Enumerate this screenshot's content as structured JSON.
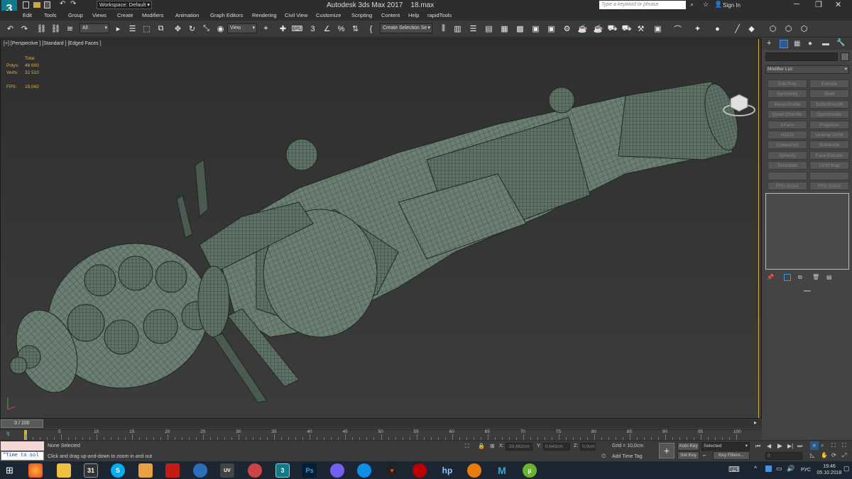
{
  "title_bar": {
    "app_icon_label": "3",
    "workspace_label": "Workspace: Default",
    "app_name": "Autodesk 3ds Max 2017",
    "file_name": "18.max",
    "search_placeholder": "Type a keyword or phrase",
    "sign_in_label": "Sign In"
  },
  "menu": [
    "Edit",
    "Tools",
    "Group",
    "Views",
    "Create",
    "Modifiers",
    "Animation",
    "Graph Editors",
    "Rendering",
    "Civil View",
    "Customize",
    "Scripting",
    "Content",
    "Help",
    "rapidTools"
  ],
  "toolbar": {
    "selection_filter": "All",
    "reference_coord": "View",
    "snaps_3": "3",
    "snaps_2": "2",
    "create_selection_set": "Create Selection Se"
  },
  "viewport": {
    "label": "[+] [Perspective ] [Standard ] [Edged Faces ]",
    "stats_header": "Total",
    "polys_label": "Polys:",
    "polys_value": "46 600",
    "verts_label": "Verts:",
    "verts_value": "32 510",
    "fps_label": "FPS:",
    "fps_value": "19,042"
  },
  "command_panel": {
    "modifier_list_label": "Modifier List",
    "modifier_buttons": [
      "Edit Poly",
      "Extrude",
      "Symmetry",
      "Shell",
      "Bevel Profile",
      "TurboSmooth",
      "Quad Chamfer",
      "OpenSubdiv",
      "XForm",
      "Projection",
      "HSDS",
      "Unwrap UVW",
      "CreaseSet",
      "Subdivide",
      "Spherify",
      "Face Extrude",
      "Tessellate",
      "UVW Map",
      "",
      "",
      "FFD 2x2x2",
      "FFD 3x3x3"
    ]
  },
  "timeline": {
    "frame_counter": "0 / 100",
    "ticks": [
      "0",
      "5",
      "10",
      "15",
      "20",
      "25",
      "30",
      "35",
      "40",
      "45",
      "50",
      "55",
      "60",
      "65",
      "70",
      "75",
      "80",
      "85",
      "90",
      "95",
      "100"
    ]
  },
  "status": {
    "maxscript_text": "\"Time to sol",
    "selection_status": "None Selected",
    "prompt": "Click and drag up-and-down to zoom in and out",
    "x_label": "X:",
    "x_value": "-33,662cm",
    "y_label": "Y:",
    "y_value": "0,645cm",
    "z_label": "Z:",
    "z_value": "0,0cm",
    "grid_label": "Grid = 10,0cm",
    "add_time_tag": "Add Time Tag",
    "auto_key": "Auto Key",
    "set_key": "Set Key",
    "selected_option": "Selected",
    "key_filters": "Key Filters...",
    "frame_field": "0"
  },
  "taskbar": {
    "apps": [
      "firefox-icon",
      "file-explorer-icon",
      "calendar-icon",
      "skype-icon",
      "folder-icon",
      "acrobat-icon",
      "app-icon",
      "uv-layout-icon",
      "magnet-icon",
      "3dsmax-icon",
      "photoshop-icon",
      "viber-icon",
      "teamviewer-icon",
      "heart-app-icon",
      "steam-icon",
      "hp-icon",
      "blender-icon",
      "maya-icon",
      "utorrent-icon"
    ],
    "icon_labels": {
      "calendar": "31",
      "skype": "S",
      "uv": "UV",
      "max": "3",
      "ps": "Ps",
      "hp": "hp",
      "maya": "M",
      "utorrent": "µ"
    },
    "lang": "РУС",
    "time": "19:46",
    "date": "05.10.2018"
  },
  "colors": {
    "model": "#6b7e72",
    "model_edge": "#1e2822",
    "accent": "#4a90d9",
    "stats": "#e8b030"
  }
}
